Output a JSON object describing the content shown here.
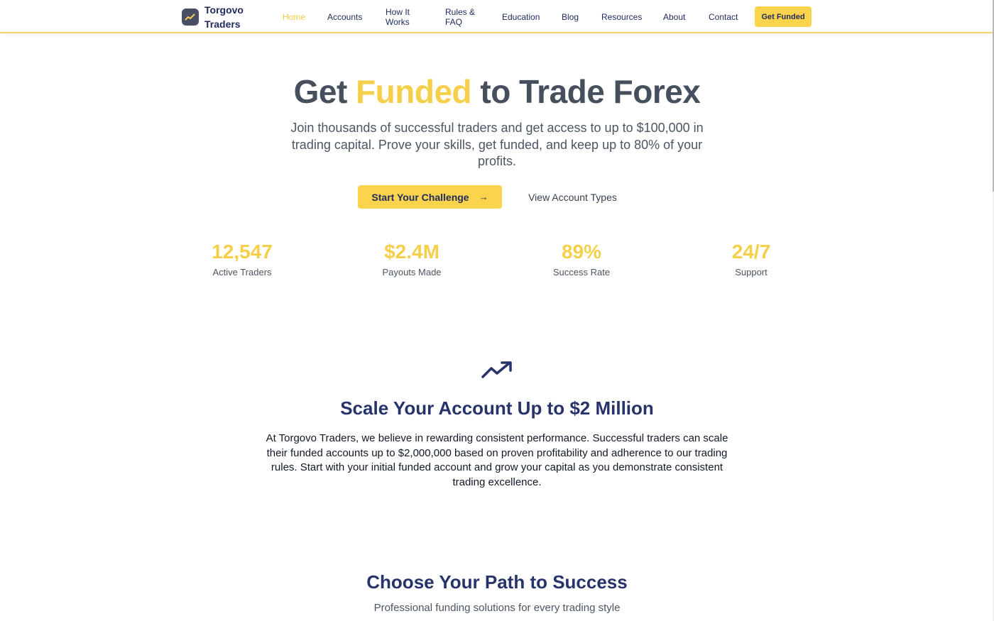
{
  "header": {
    "brand_line1": "Torgovo",
    "brand_line2": "Traders",
    "nav": [
      {
        "label": "Home",
        "active": true
      },
      {
        "label": "Accounts"
      },
      {
        "label": "How It Works"
      },
      {
        "label": "Rules & FAQ"
      },
      {
        "label": "Education"
      },
      {
        "label": "Blog"
      },
      {
        "label": "Resources"
      },
      {
        "label": "About"
      },
      {
        "label": "Contact"
      }
    ],
    "cta_label": "Get Funded"
  },
  "hero": {
    "title_part1": "Get ",
    "title_accent": "Funded",
    "title_part2": " to Trade Forex",
    "subtitle": "Join thousands of successful traders and get access to up to $100,000 in trading capital. Prove your skills, get funded, and keep up to 80% of your profits.",
    "primary_button": "Start Your Challenge",
    "primary_arrow": "→",
    "secondary_button": "View Account Types"
  },
  "stats": [
    {
      "value": "12,547",
      "label": "Active Traders"
    },
    {
      "value": "$2.4M",
      "label": "Payouts Made"
    },
    {
      "value": "89%",
      "label": "Success Rate"
    },
    {
      "value": "24/7",
      "label": "Support"
    }
  ],
  "scale": {
    "icon": "trending-up-icon",
    "title": "Scale Your Account Up to $2 Million",
    "body": "At Torgovo Traders, we believe in rewarding consistent performance. Successful traders can scale their funded accounts up to $2,000,000 based on proven profitability and adherence to our trading rules. Start with your initial funded account and grow your capital as you demonstrate consistent trading excellence."
  },
  "path": {
    "title": "Choose Your Path to Success",
    "subtitle": "Professional funding solutions for every trading style"
  },
  "colors": {
    "accent": "#fcd34d",
    "navy": "#1e2a5e",
    "heading_gray": "#464f5e"
  }
}
